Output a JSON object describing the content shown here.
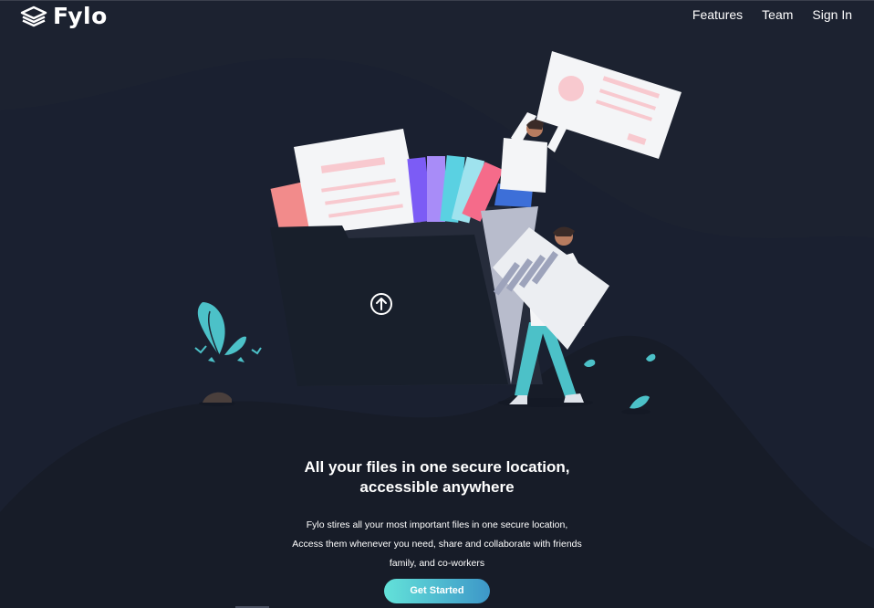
{
  "header": {
    "logo_text": "Fylo",
    "nav": [
      {
        "label": "Features"
      },
      {
        "label": "Team"
      },
      {
        "label": "Sign In"
      }
    ]
  },
  "hero": {
    "headline": "All your files in one secure location, accessible anywhere",
    "description": "Fylo stires all your most important files in one secure location, Access them whenever you need, share and collaborate with friends family, and co-workers",
    "cta_label": "Get Started"
  },
  "icons": {
    "logo": "stacked-layers-icon",
    "upload": "upload-arrow-icon"
  },
  "colors": {
    "background": "#1c2230",
    "background_curve": "#181e2a",
    "folder": "#181f2b",
    "accent_start": "#63e2d9",
    "accent_end": "#3d97c8",
    "text": "#ffffff"
  }
}
